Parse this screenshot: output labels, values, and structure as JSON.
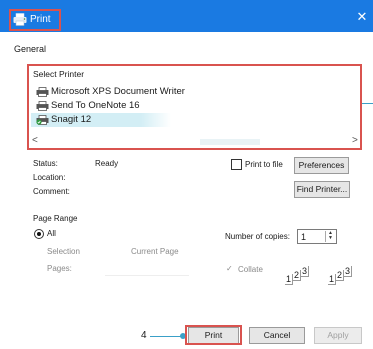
{
  "window": {
    "title": "Print",
    "close_glyph": "✕"
  },
  "tab": "General",
  "select_printer": {
    "label": "Select Printer",
    "printers": [
      "Microsoft XPS Document Writer",
      "Send To OneNote 16",
      "Snagit 12"
    ],
    "selected": "Snagit 12",
    "scroll_left": "<",
    "scroll_right": ">"
  },
  "status": {
    "status_label": "Status:",
    "status_value": "Ready",
    "location_label": "Location:",
    "comment_label": "Comment:",
    "print_to_file_label": "Print to file",
    "print_to_file_checked": false,
    "preferences_button": "Preferences",
    "find_printer_button": "Find Printer..."
  },
  "page_range": {
    "label": "Page Range",
    "all_label": "All",
    "selection_label": "Selection",
    "current_page_label": "Current Page",
    "pages_label": "Pages:",
    "pages_value": ""
  },
  "copies": {
    "label": "Number of copies:",
    "value": "1",
    "collate_label": "Collate",
    "collate_checked": true
  },
  "footer": {
    "step_number": "4",
    "print_button": "Print",
    "cancel_button": "Cancel",
    "apply_button": "Apply"
  },
  "colors": {
    "titlebar": "#1a7ae2",
    "highlight": "#d9534f",
    "callout": "#3aa0c8",
    "selection": "#d3eef5"
  }
}
